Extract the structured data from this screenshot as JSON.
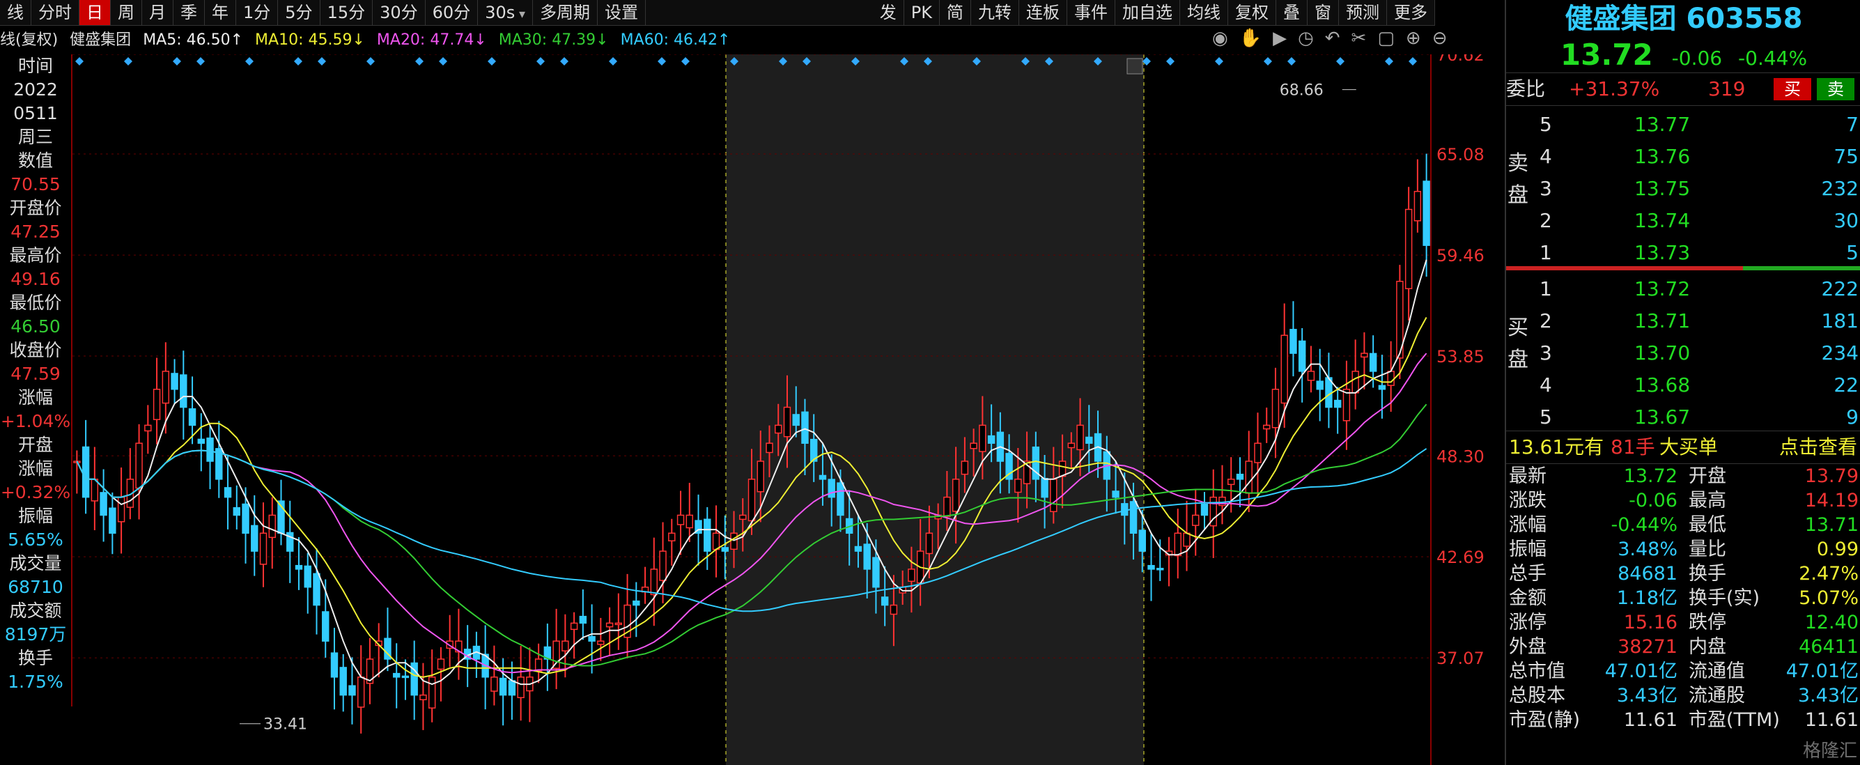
{
  "toolbar": {
    "items": [
      "线",
      "分时",
      "日",
      "周",
      "月",
      "季",
      "年",
      "1分",
      "5分",
      "15分",
      "30分",
      "60分",
      "30s",
      "多周期",
      "设置"
    ],
    "active_index": 2,
    "right_items": [
      "发",
      "PK",
      "简",
      "九转",
      "连板",
      "事件",
      "加自选",
      "均线",
      "复权",
      "叠",
      "窗",
      "预测",
      "更多"
    ]
  },
  "ma_line": {
    "prefix": "线(复权)",
    "stock": "健盛集团",
    "ma5": "MA5: 46.50↑",
    "ma10": "MA10: 45.59↓",
    "ma20": "MA20: 47.74↓",
    "ma30": "MA30: 47.39↓",
    "ma60": "MA60: 46.42↑"
  },
  "left_info": {
    "time_label": "时间",
    "year": "2022",
    "date": "0511",
    "weekday": "周三",
    "value_label": "数值",
    "value": "70.55",
    "open_label": "开盘价",
    "open": "47.25",
    "high_label": "最高价",
    "high": "49.16",
    "low_label": "最低价",
    "low": "46.50",
    "close_label": "收盘价",
    "close": "47.59",
    "change_label": "涨幅",
    "change": "+1.04%",
    "open_chg_label1": "开盘",
    "open_chg_label2": "涨幅",
    "open_chg": "+0.32%",
    "amp_label": "振幅",
    "amp": "5.65%",
    "vol_label": "成交量",
    "vol": "68710",
    "amount_label": "成交额",
    "amount": "8197万",
    "turnover_label": "换手",
    "turnover": "1.75%"
  },
  "chart_data": {
    "type": "candlestick",
    "y_ticks": [
      "70.62",
      "65.08",
      "59.46",
      "53.85",
      "48.30",
      "42.69",
      "37.07"
    ],
    "ylim": [
      31.5,
      70.62
    ],
    "high_mark": "68.66",
    "low_mark": "33.41",
    "closes": [
      48,
      46,
      47,
      45,
      44,
      46,
      47,
      49,
      50,
      52,
      53,
      52,
      51,
      50,
      49,
      48,
      47,
      46,
      45,
      44,
      43,
      44,
      45,
      44,
      43,
      42,
      41,
      40,
      38,
      36,
      35,
      35,
      36,
      37,
      38,
      37,
      36,
      36,
      35,
      35,
      36,
      37,
      38,
      38,
      37,
      37,
      36,
      36,
      35,
      35,
      36,
      36,
      37,
      37,
      38,
      38,
      39,
      39,
      38,
      38,
      39,
      39,
      40,
      40,
      41,
      42,
      43,
      44,
      45,
      45,
      44,
      43,
      44,
      43,
      44,
      45,
      47,
      48,
      49,
      50,
      51,
      50,
      49,
      48,
      47,
      46,
      45,
      44,
      43,
      42,
      41,
      40,
      40,
      41,
      42,
      43,
      44,
      45,
      46,
      47,
      48,
      49,
      50,
      49,
      48,
      47,
      47,
      48,
      47,
      46,
      47,
      48,
      49,
      50,
      49,
      48,
      47,
      46,
      45,
      44,
      43,
      42,
      42,
      43,
      44,
      44,
      45,
      45,
      46,
      46,
      47,
      47,
      48,
      49,
      50,
      52,
      55,
      54,
      53,
      53,
      52,
      51,
      51,
      52,
      53,
      54,
      53,
      52,
      53,
      58,
      62,
      63,
      60
    ]
  },
  "right_panel": {
    "title": "健盛集团 603558",
    "price": "13.72",
    "change": "-0.06",
    "change_pct": "-0.44%",
    "weibi_label": "委比",
    "weibi": "+31.37%",
    "weicha": "319",
    "buy_btn": "买",
    "sell_btn": "卖",
    "sell_label": [
      "卖",
      "盘"
    ],
    "buy_label": [
      "买",
      "盘"
    ],
    "asks": [
      {
        "lvl": "5",
        "price": "13.77",
        "vol": "7"
      },
      {
        "lvl": "4",
        "price": "13.76",
        "vol": "75"
      },
      {
        "lvl": "3",
        "price": "13.75",
        "vol": "232"
      },
      {
        "lvl": "2",
        "price": "13.74",
        "vol": "30"
      },
      {
        "lvl": "1",
        "price": "13.73",
        "vol": "5"
      }
    ],
    "bids": [
      {
        "lvl": "1",
        "price": "13.72",
        "vol": "222"
      },
      {
        "lvl": "2",
        "price": "13.71",
        "vol": "181"
      },
      {
        "lvl": "3",
        "price": "13.70",
        "vol": "234"
      },
      {
        "lvl": "4",
        "price": "13.68",
        "vol": "22"
      },
      {
        "lvl": "5",
        "price": "13.67",
        "vol": "9"
      }
    ],
    "big_order": {
      "price": "13.61元有",
      "qty": "81手",
      "text": "大买单",
      "link": "点击查看"
    },
    "stats": [
      {
        "l1": "最新",
        "v1": "13.72",
        "c1": "gr",
        "l2": "开盘",
        "v2": "13.79",
        "c2": "rd"
      },
      {
        "l1": "涨跌",
        "v1": "-0.06",
        "c1": "gr",
        "l2": "最高",
        "v2": "14.19",
        "c2": "rd"
      },
      {
        "l1": "涨幅",
        "v1": "-0.44%",
        "c1": "gr",
        "l2": "最低",
        "v2": "13.71",
        "c2": "gr"
      },
      {
        "l1": "振幅",
        "v1": "3.48%",
        "c1": "cy",
        "l2": "量比",
        "v2": "0.99",
        "c2": "yl"
      },
      {
        "l1": "总手",
        "v1": "84681",
        "c1": "cy",
        "l2": "换手",
        "v2": "2.47%",
        "c2": "yl"
      },
      {
        "l1": "金额",
        "v1": "1.18亿",
        "c1": "cy",
        "l2": "换手(实)",
        "v2": "5.07%",
        "c2": "yl"
      },
      {
        "l1": "涨停",
        "v1": "15.16",
        "c1": "rd",
        "l2": "跌停",
        "v2": "12.40",
        "c2": "gr"
      },
      {
        "l1": "外盘",
        "v1": "38271",
        "c1": "rd",
        "l2": "内盘",
        "v2": "46411",
        "c2": "gr"
      },
      {
        "l1": "总市值",
        "v1": "47.01亿",
        "c1": "cy",
        "l2": "流通值",
        "v2": "47.01亿",
        "c2": "cy"
      },
      {
        "l1": "总股本",
        "v1": "3.43亿",
        "c1": "cy",
        "l2": "流通股",
        "v2": "3.43亿",
        "c2": "cy"
      },
      {
        "l1": "市盈(静)",
        "v1": "11.61",
        "c1": "wh",
        "l2": "市盈(TTM)",
        "v2": "11.61",
        "c2": "wh"
      }
    ],
    "watermark": "格隆汇"
  }
}
